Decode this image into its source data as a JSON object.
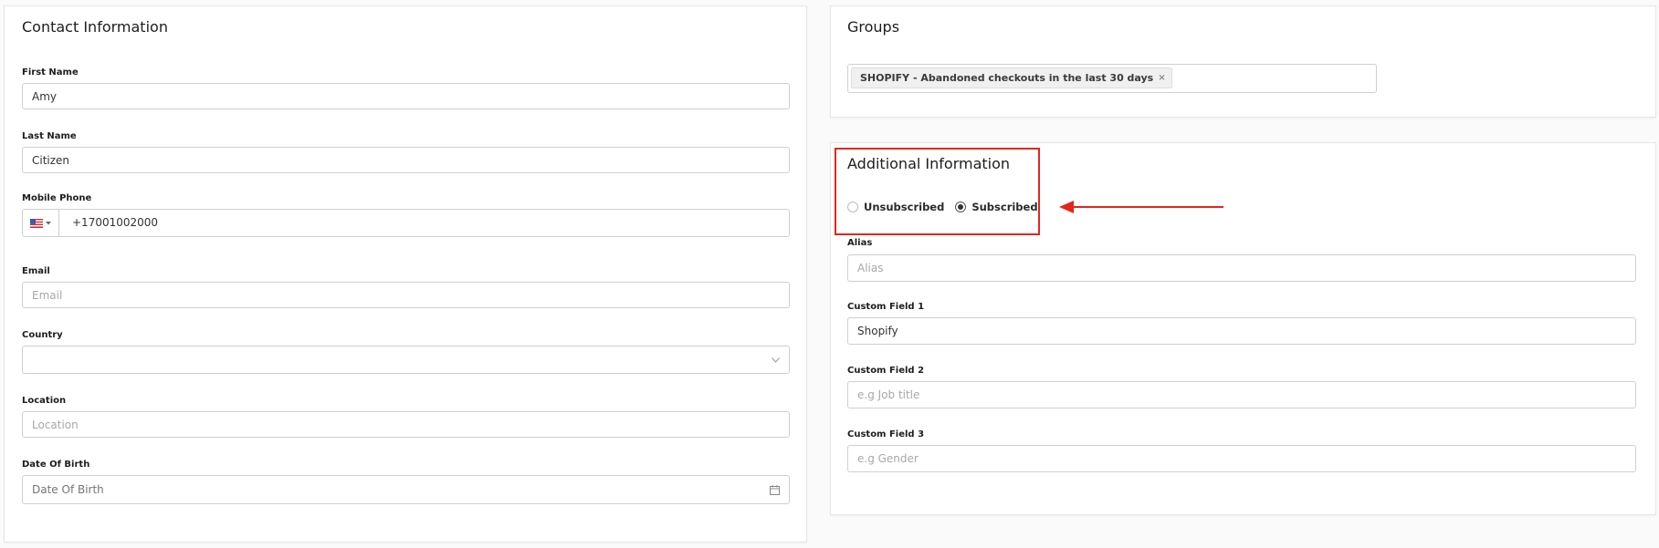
{
  "contact": {
    "title": "Contact Information",
    "first_name": {
      "label": "First Name",
      "value": "Amy"
    },
    "last_name": {
      "label": "Last Name",
      "value": "Citizen"
    },
    "mobile_phone": {
      "label": "Mobile Phone",
      "value": "+17001002000",
      "country_flag": "us-flag-icon"
    },
    "email": {
      "label": "Email",
      "placeholder": "Email"
    },
    "country": {
      "label": "Country",
      "value": ""
    },
    "location": {
      "label": "Location",
      "placeholder": "Location"
    },
    "dob": {
      "label": "Date Of Birth",
      "placeholder": "Date Of Birth"
    }
  },
  "groups": {
    "title": "Groups",
    "tags": [
      {
        "label": "SHOPIFY - Abandoned checkouts in the last 30 days",
        "remove": "×"
      }
    ]
  },
  "additional": {
    "title": "Additional Information",
    "subscription": {
      "options": [
        {
          "label": "Unsubscribed",
          "selected": false
        },
        {
          "label": "Subscribed",
          "selected": true
        }
      ]
    },
    "alias": {
      "label": "Alias",
      "placeholder": "Alias"
    },
    "custom1": {
      "label": "Custom Field 1",
      "value": "Shopify"
    },
    "custom2": {
      "label": "Custom Field 2",
      "placeholder": "e.g Job title"
    },
    "custom3": {
      "label": "Custom Field 3",
      "placeholder": "e.g Gender"
    }
  },
  "annotation": {
    "color": "#e3261c"
  }
}
